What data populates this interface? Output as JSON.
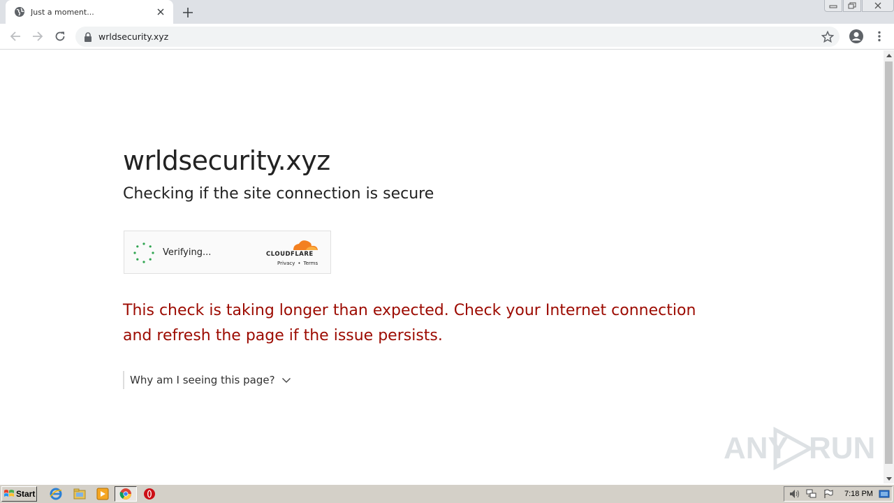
{
  "browser": {
    "tab_title": "Just a moment...",
    "url": "wrldsecurity.xyz"
  },
  "page": {
    "site_name": "wrldsecurity.xyz",
    "subtitle": "Checking if the site connection is secure",
    "widget": {
      "status": "Verifying...",
      "brand": "CLOUDFLARE",
      "privacy_link": "Privacy",
      "separator": "•",
      "terms_link": "Terms"
    },
    "warning": "This check is taking longer than expected. Check your Internet connection and refresh the page if the issue persists.",
    "why_label": "Why am I seeing this page?"
  },
  "watermark": {
    "left_text": "ANY",
    "right_text": "RUN"
  },
  "taskbar": {
    "start_label": "Start",
    "clock": "7:18 PM",
    "pinned": [
      "ie-icon",
      "explorer-icon",
      "media-player-icon",
      "chrome-icon",
      "opera-icon"
    ]
  },
  "colors": {
    "warning_text": "#9c0a00",
    "cloudflare_orange": "#f38020",
    "spinner_green": "#2ea44f"
  }
}
